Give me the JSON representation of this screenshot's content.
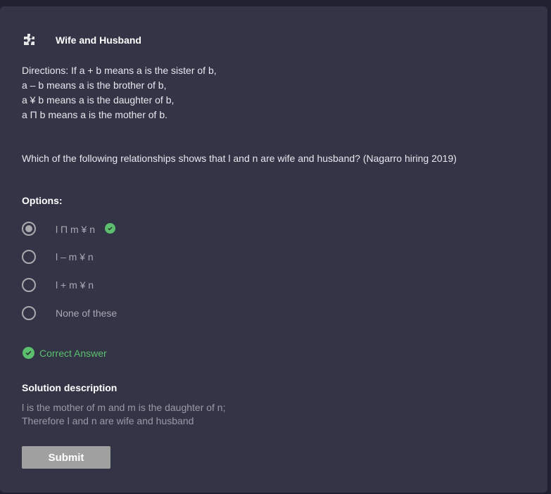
{
  "question": {
    "title": "Wife and Husband",
    "icon": "puzzle-icon",
    "directions": [
      "Directions: If a + b means a is the sister of b,",
      "a – b means a is the brother of b,",
      "a ¥ b means a is the daughter of b,",
      "a Π b means a is the mother of b."
    ],
    "text": "Which of the following relationships shows that l and n are wife and husband? (Nagarro hiring 2019)"
  },
  "options_label": "Options:",
  "options": [
    {
      "label": "l Π m ¥ n",
      "selected": true,
      "correct": true
    },
    {
      "label": "l – m ¥ n",
      "selected": false,
      "correct": false
    },
    {
      "label": "l + m ¥ n",
      "selected": false,
      "correct": false
    },
    {
      "label": "None of these",
      "selected": false,
      "correct": false
    }
  ],
  "result": "Correct Answer",
  "solution": {
    "title": "Solution description",
    "lines": [
      "l is the mother of m and m is the daughter of n;",
      "Therefore l and n are wife and husband"
    ]
  },
  "submit_label": "Submit",
  "colors": {
    "correct": "#5cbf6e",
    "card": "#333446",
    "background": "#1f2030"
  }
}
